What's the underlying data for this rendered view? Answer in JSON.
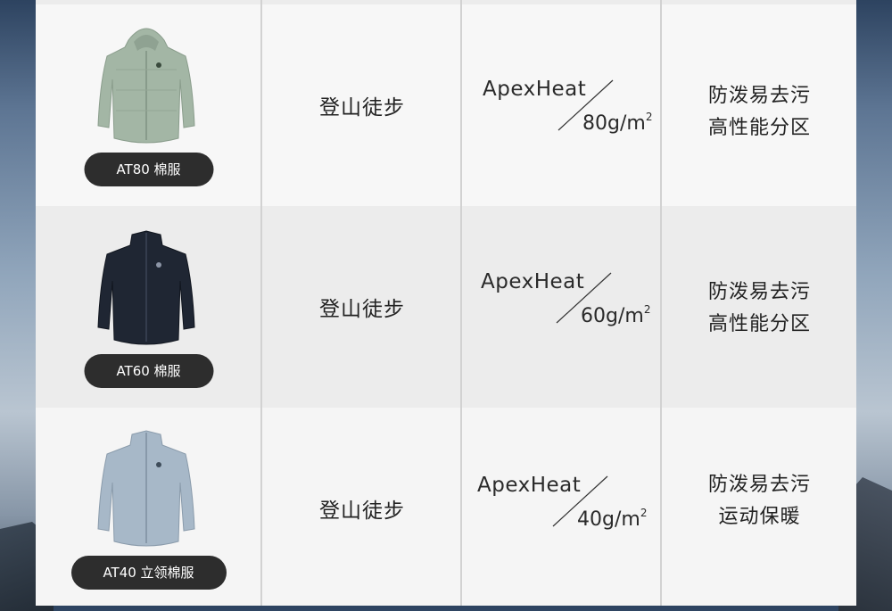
{
  "colors": {
    "table_bg": "#f5f5f5",
    "alt_row_bg": "#ececec",
    "pill_bg": "#2d2d2d",
    "pill_text": "#ffffff",
    "text": "#222222",
    "jacket_sage": "#a3b6a5",
    "jacket_navy": "#1f2633",
    "jacket_blue": "#a7b8c8"
  },
  "rows": [
    {
      "product_label": "AT80 棉服",
      "jacket_icon": "hooded-jacket-sage",
      "use": "登山徒步",
      "fill_brand": "ApexHeat",
      "fill_weight": "80g/m",
      "fill_sup": "2",
      "features": [
        "防泼易去污",
        "高性能分区"
      ]
    },
    {
      "product_label": "AT60 棉服",
      "jacket_icon": "collar-jacket-navy",
      "use": "登山徒步",
      "fill_brand": "ApexHeat",
      "fill_weight": "60g/m",
      "fill_sup": "2",
      "features": [
        "防泼易去污",
        "高性能分区"
      ]
    },
    {
      "product_label": "AT40 立领棉服",
      "jacket_icon": "collar-jacket-light-blue",
      "use": "登山徒步",
      "fill_brand": "ApexHeat",
      "fill_weight": "40g/m",
      "fill_sup": "2",
      "features": [
        "防泼易去污",
        "运动保暖"
      ]
    }
  ]
}
